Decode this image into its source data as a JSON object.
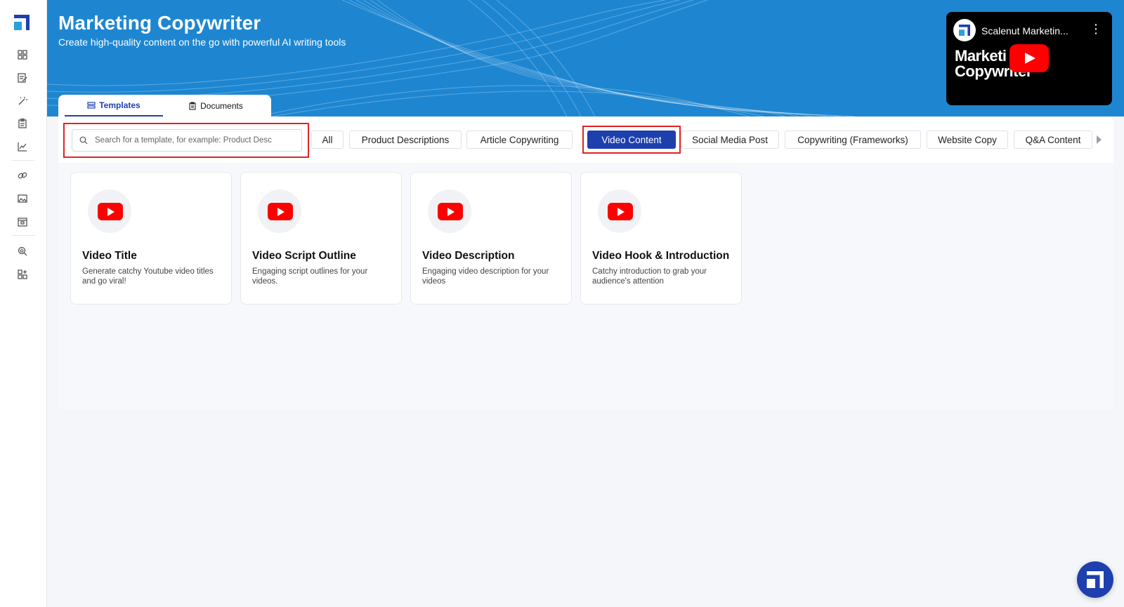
{
  "colors": {
    "banner": "#1e86d1",
    "primary": "#1e3fae",
    "highlight": "#e02424",
    "youtube": "#ff0000"
  },
  "sidebar": {
    "logo": "scalenut-logo",
    "items": [
      {
        "icon": "dashboard-grid-icon"
      },
      {
        "icon": "document-edit-icon"
      },
      {
        "icon": "magic-wand-icon"
      },
      {
        "icon": "clipboard-icon"
      },
      {
        "icon": "trend-chart-icon"
      },
      {
        "icon": "link-icon"
      },
      {
        "icon": "image-icon"
      },
      {
        "icon": "calendar-icon"
      },
      {
        "icon": "search-star-icon"
      },
      {
        "icon": "apps-grid-icon"
      }
    ]
  },
  "banner": {
    "title": "Marketing Copywriter",
    "subtitle": "Create high-quality content on the go with powerful AI writing tools"
  },
  "video": {
    "channel_title": "Scalenut Marketin...",
    "thumb_line1": "Marketi",
    "thumb_line2": "Copywriter"
  },
  "tabs": [
    {
      "label": "Templates",
      "icon": "templates-icon",
      "active": true
    },
    {
      "label": "Documents",
      "icon": "documents-icon",
      "active": false
    }
  ],
  "search": {
    "placeholder": "Search for a template, for example: Product Desc",
    "value": ""
  },
  "categories": [
    {
      "label": "All"
    },
    {
      "label": "Product Descriptions"
    },
    {
      "label": "Article Copywriting"
    },
    {
      "label": "Video Content",
      "active": true
    },
    {
      "label": "Social Media Post"
    },
    {
      "label": "Copywriting (Frameworks)"
    },
    {
      "label": "Website Copy"
    },
    {
      "label": "Q&A Content"
    }
  ],
  "cards": [
    {
      "title": "Video Title",
      "description": "Generate catchy Youtube video titles and go viral!"
    },
    {
      "title": "Video Script Outline",
      "description": "Engaging script outlines for your videos."
    },
    {
      "title": "Video Description",
      "description": "Engaging video description for your videos"
    },
    {
      "title": "Video Hook & Introduction",
      "description": "Catchy introduction to grab your audience's attention"
    }
  ]
}
